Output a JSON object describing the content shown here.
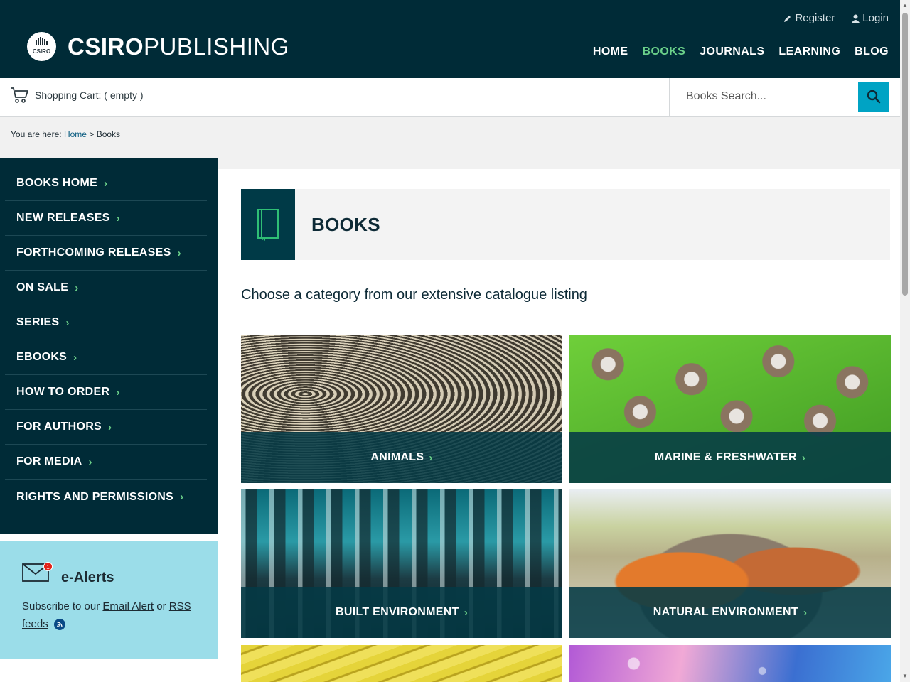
{
  "brand": {
    "logo_mark": "CSIRO",
    "name_bold": "CSIRO",
    "name_light": "PUBLISHING"
  },
  "util": {
    "register": "Register",
    "login": "Login"
  },
  "nav": {
    "items": [
      "HOME",
      "BOOKS",
      "JOURNALS",
      "LEARNING",
      "BLOG"
    ],
    "active": "BOOKS"
  },
  "cart": {
    "label": "Shopping Cart: ( empty )"
  },
  "search": {
    "placeholder": "Books Search..."
  },
  "breadcrumb": {
    "prefix": "You are here:",
    "home": "Home",
    "separator": ">",
    "current": "Books"
  },
  "sidebar": {
    "items": [
      {
        "label": "BOOKS HOME"
      },
      {
        "label": "NEW RELEASES"
      },
      {
        "label": "FORTHCOMING RELEASES"
      },
      {
        "label": "ON SALE"
      },
      {
        "label": "SERIES"
      },
      {
        "label": "EBOOKS"
      },
      {
        "label": "HOW TO ORDER"
      },
      {
        "label": "FOR AUTHORS"
      },
      {
        "label": "FOR MEDIA"
      },
      {
        "label": "RIGHTS AND PERMISSIONS"
      }
    ]
  },
  "ealerts": {
    "badge": "1",
    "title": "e-Alerts",
    "text_before": "Subscribe to our",
    "email_link": "Email Alert",
    "text_or": "or",
    "rss_link": "RSS feeds"
  },
  "page": {
    "title": "BOOKS",
    "intro": "Choose a category from our extensive catalogue listing"
  },
  "categories": [
    {
      "label": "ANIMALS"
    },
    {
      "label": "MARINE & FRESHWATER"
    },
    {
      "label": "BUILT ENVIRONMENT"
    },
    {
      "label": "NATURAL ENVIRONMENT"
    }
  ],
  "colors": {
    "header_bg": "#002b37",
    "accent_green": "#6bd18a",
    "search_button": "#00a3c4",
    "ealerts_bg": "#9bdde9"
  },
  "icons": {
    "register": "pencil-icon",
    "login": "user-icon",
    "cart": "cart-icon",
    "search": "search-icon",
    "book": "book-icon",
    "mail": "mail-icon",
    "rss": "rss-icon",
    "chevron": "chevron-right-icon"
  },
  "chevron_glyph": "›"
}
